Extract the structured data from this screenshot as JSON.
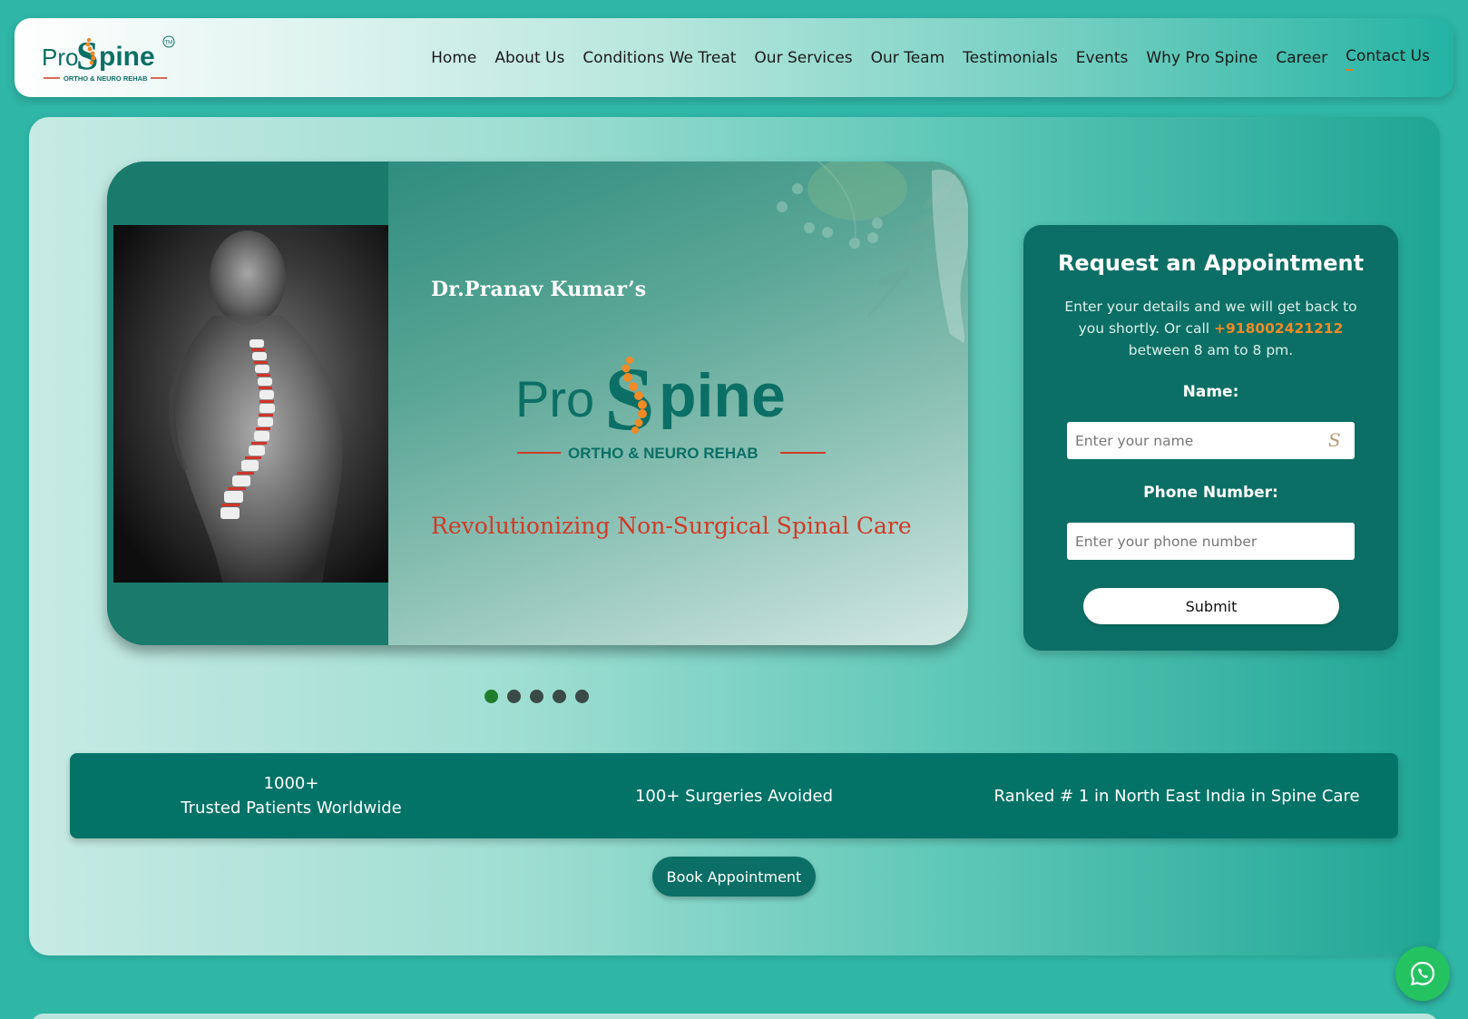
{
  "brand": {
    "name_pro": "Pro",
    "name_s": "S",
    "name_pine": "pine",
    "subtitle": "ORTHO & NEURO REHAB",
    "tm": "TM",
    "colors": {
      "teal": "#0c6f65",
      "orange": "#f08a26",
      "red": "#d03a27"
    }
  },
  "nav": {
    "items": [
      {
        "label": "Home"
      },
      {
        "label": "About Us"
      },
      {
        "label": "Conditions We Treat"
      },
      {
        "label": "Our Services"
      },
      {
        "label": "Our Team"
      },
      {
        "label": "Testimonials"
      },
      {
        "label": "Events"
      },
      {
        "label": "Why Pro Spine"
      },
      {
        "label": "Career"
      },
      {
        "label": "Contact Us"
      }
    ]
  },
  "banner": {
    "doctor": "Dr.Pranav Kumar’s",
    "tagline": "Revolutionizing Non-Surgical Spinal Care",
    "slide_count": 5,
    "active_slide": 1
  },
  "form": {
    "title": "Request an Appointment",
    "desc_before": "Enter your details and we will get back to you shortly. Or call",
    "phone": "+918002421212",
    "desc_after": "between 8 am to 8 pm.",
    "name_label": "Name:",
    "name_placeholder": "Enter your name",
    "phone_label": "Phone Number:",
    "phone_placeholder": "Enter your phone number",
    "submit": "Submit"
  },
  "stats": {
    "patients_count": "1000+",
    "patients_label": "Trusted Patients Worldwide",
    "surgeries": "100+ Surgeries Avoided",
    "ranked": "Ranked # 1 in North East India in Spine Care"
  },
  "cta": {
    "book": "Book Appointment"
  },
  "icons": {
    "whatsapp": "whatsapp-icon",
    "input": "s-brand-icon"
  }
}
